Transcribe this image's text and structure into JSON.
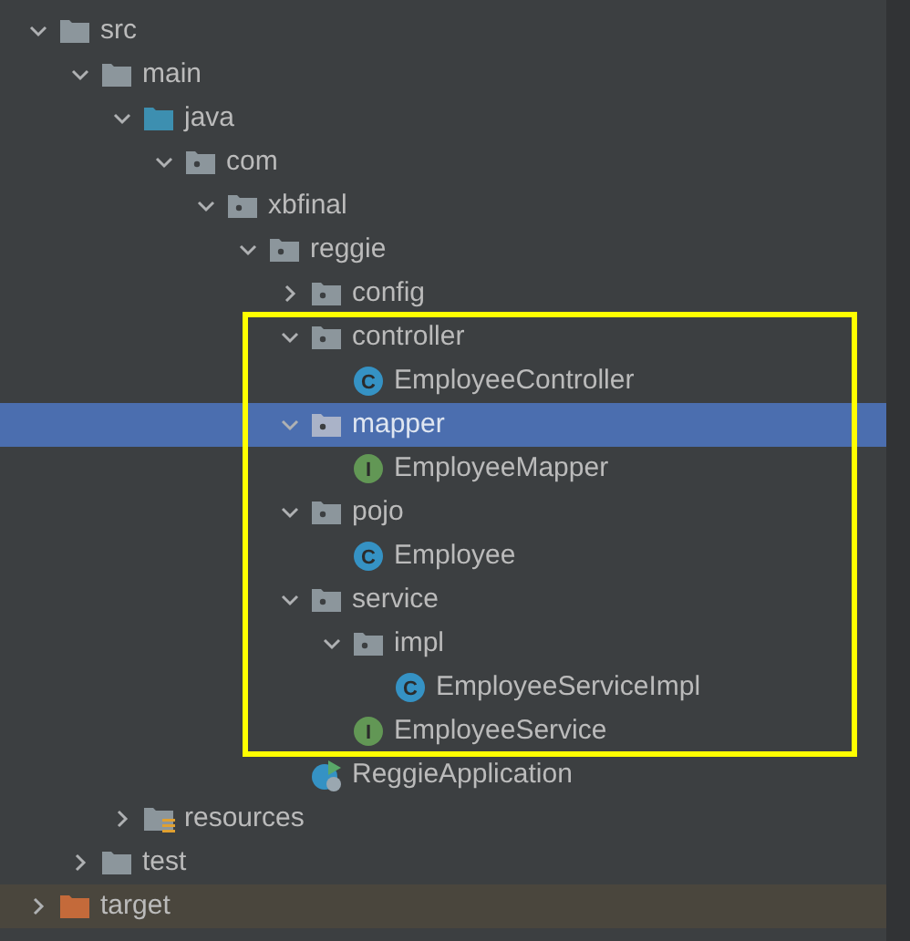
{
  "project_tree": [
    {
      "label": "src",
      "kind": "folder",
      "expanded": true,
      "selected": false,
      "children": [
        {
          "label": "main",
          "kind": "folder",
          "expanded": true,
          "selected": false,
          "children": [
            {
              "label": "java",
              "kind": "source-root",
              "expanded": true,
              "selected": false,
              "children": [
                {
                  "label": "com",
                  "kind": "package",
                  "expanded": true,
                  "selected": false,
                  "children": [
                    {
                      "label": "xbfinal",
                      "kind": "package",
                      "expanded": true,
                      "selected": false,
                      "children": [
                        {
                          "label": "reggie",
                          "kind": "package",
                          "expanded": true,
                          "selected": false,
                          "children": [
                            {
                              "label": "config",
                              "kind": "package",
                              "expanded": false,
                              "selected": false
                            },
                            {
                              "kind": "highlight-frame",
                              "color": "#ffff00",
                              "children": [
                                {
                                  "label": "controller",
                                  "kind": "package",
                                  "expanded": true,
                                  "selected": false,
                                  "children": [
                                    {
                                      "label": "EmployeeController",
                                      "kind": "class",
                                      "icon_letter": "C",
                                      "selected": false
                                    }
                                  ]
                                },
                                {
                                  "label": "mapper",
                                  "kind": "package",
                                  "expanded": true,
                                  "selected": true,
                                  "children": [
                                    {
                                      "label": "EmployeeMapper",
                                      "kind": "interface",
                                      "icon_letter": "I",
                                      "selected": false
                                    }
                                  ]
                                },
                                {
                                  "label": "pojo",
                                  "kind": "package",
                                  "expanded": true,
                                  "selected": false,
                                  "children": [
                                    {
                                      "label": "Employee",
                                      "kind": "class",
                                      "icon_letter": "C",
                                      "selected": false
                                    }
                                  ]
                                },
                                {
                                  "label": "service",
                                  "kind": "package",
                                  "expanded": true,
                                  "selected": false,
                                  "children": [
                                    {
                                      "label": "impl",
                                      "kind": "package",
                                      "expanded": true,
                                      "selected": false,
                                      "children": [
                                        {
                                          "label": "EmployeeServiceImpl",
                                          "kind": "class",
                                          "icon_letter": "C",
                                          "selected": false
                                        }
                                      ]
                                    },
                                    {
                                      "label": "EmployeeService",
                                      "kind": "interface",
                                      "icon_letter": "I",
                                      "selected": false
                                    }
                                  ]
                                }
                              ]
                            },
                            {
                              "label": "ReggieApplication",
                              "kind": "spring-app",
                              "selected": false
                            }
                          ]
                        }
                      ]
                    }
                  ]
                }
              ]
            },
            {
              "label": "resources",
              "kind": "resources",
              "expanded": false,
              "selected": false
            }
          ]
        },
        {
          "label": "test",
          "kind": "folder",
          "expanded": false,
          "selected": false
        }
      ]
    },
    {
      "label": "target",
      "kind": "excluded",
      "expanded": false,
      "selected": false
    }
  ]
}
